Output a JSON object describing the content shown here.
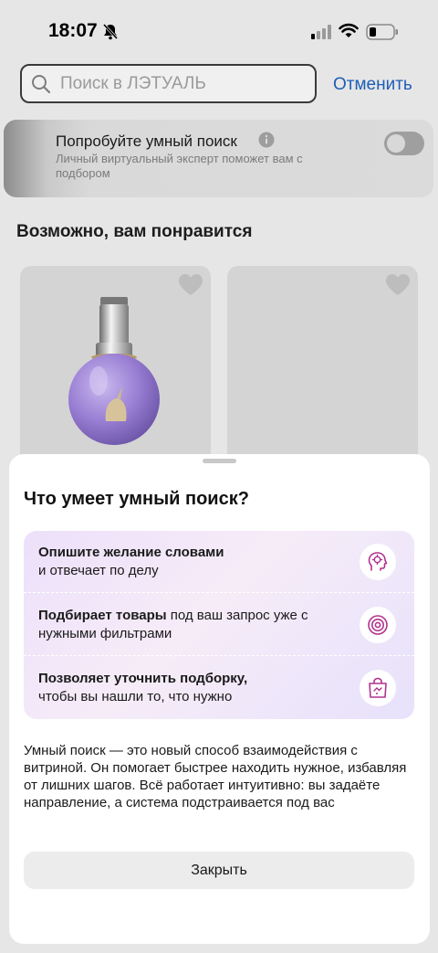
{
  "status": {
    "time": "18:07"
  },
  "search": {
    "placeholder": "Поиск в ЛЭТУАЛЬ",
    "cancel_label": "Отменить"
  },
  "smart_search": {
    "title": "Попробуйте умный поиск",
    "description": "Личный виртуальный эксперт поможет вам с подбором",
    "enabled": false
  },
  "recommendations": {
    "title": "Возможно, вам понравится"
  },
  "sheet": {
    "title": "Что умеет умный поиск?",
    "features": [
      {
        "bold": "Опишите желание словами",
        "rest": "и отвечает по делу",
        "icon": "head-idea-icon"
      },
      {
        "bold": "Подбирает товары",
        "rest": "под ваш запрос уже с нужными фильтрами",
        "icon": "target-icon"
      },
      {
        "bold": "Позволяет уточнить подборку,",
        "rest": "чтобы вы нашли то, что нужно",
        "icon": "shopping-bag-icon"
      }
    ],
    "description": "Умный поиск — это новый способ взаимодействия с витриной. Он помогает быстрее находить нужное, избавляя от лишних шагов. Всё работает интуитивно: вы задаёте направление, а система подстраивается под вас",
    "close_label": "Закрыть"
  },
  "colors": {
    "accent_link": "#1d5fb5",
    "icon_magenta": "#b0338f"
  }
}
